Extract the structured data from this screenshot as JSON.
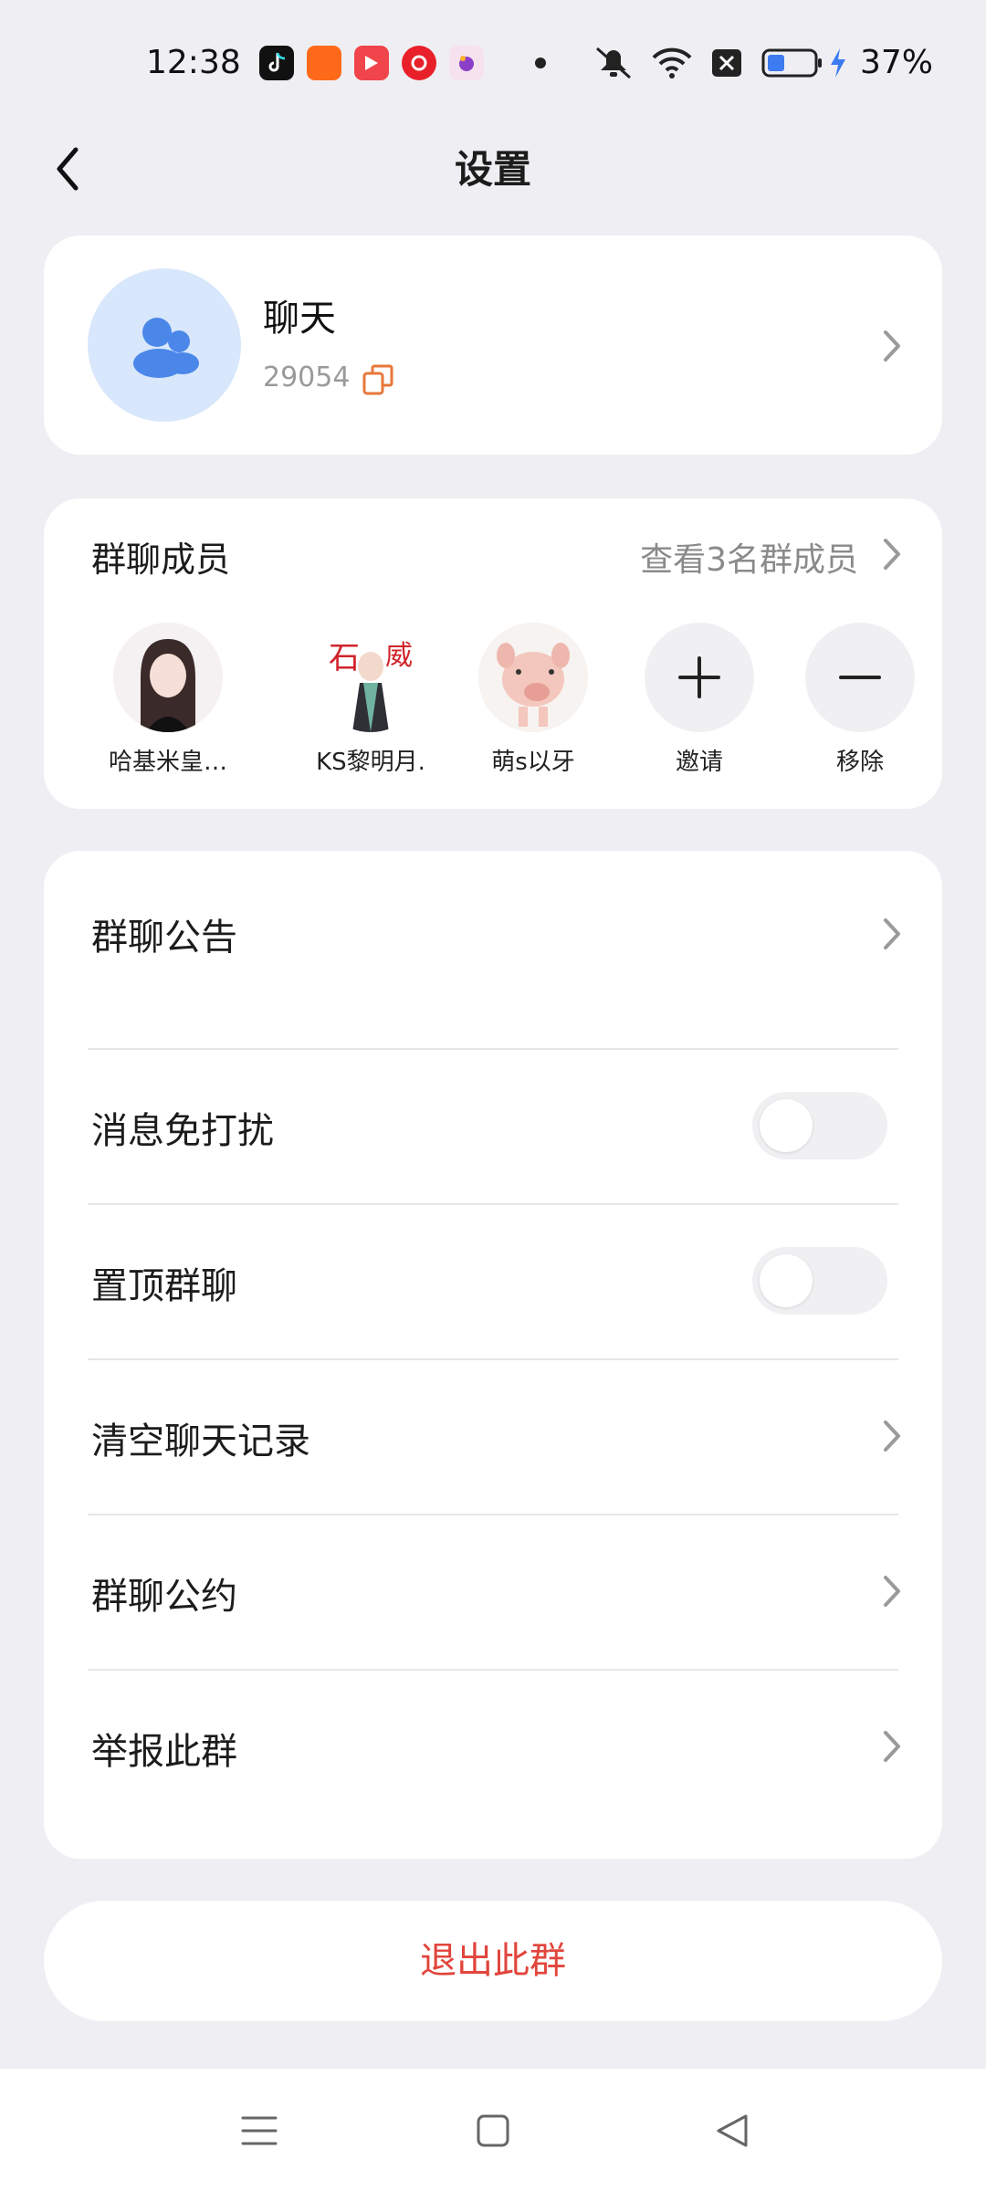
{
  "status_bar": {
    "time": "12:38",
    "battery": "37%",
    "icons": [
      "tiktok-icon",
      "kuaishou-icon",
      "video-app-icon",
      "netease-music-icon",
      "game-app-icon",
      "mute-icon",
      "wifi-icon",
      "sim-off-icon",
      "battery-icon",
      "charging-icon"
    ]
  },
  "header": {
    "title": "设置"
  },
  "group": {
    "name": "聊天",
    "id": "29054"
  },
  "members": {
    "title": "群聊成员",
    "view_all": "查看3名群成员",
    "list": [
      {
        "name": "哈基米皇…"
      },
      {
        "name": "KS黎明月."
      },
      {
        "name": "萌s以牙"
      }
    ],
    "invite_label": "邀请",
    "remove_label": "移除"
  },
  "settings": {
    "announcement": "群聊公告",
    "mute": "消息免打扰",
    "mute_on": false,
    "pin": "置顶群聊",
    "pin_on": false,
    "clear_history": "清空聊天记录",
    "rules": "群聊公约",
    "report": "举报此群"
  },
  "exit_label": "退出此群",
  "colors": {
    "accent_blue": "#4a87e8",
    "danger": "#e1453c",
    "background": "#efeff3"
  }
}
